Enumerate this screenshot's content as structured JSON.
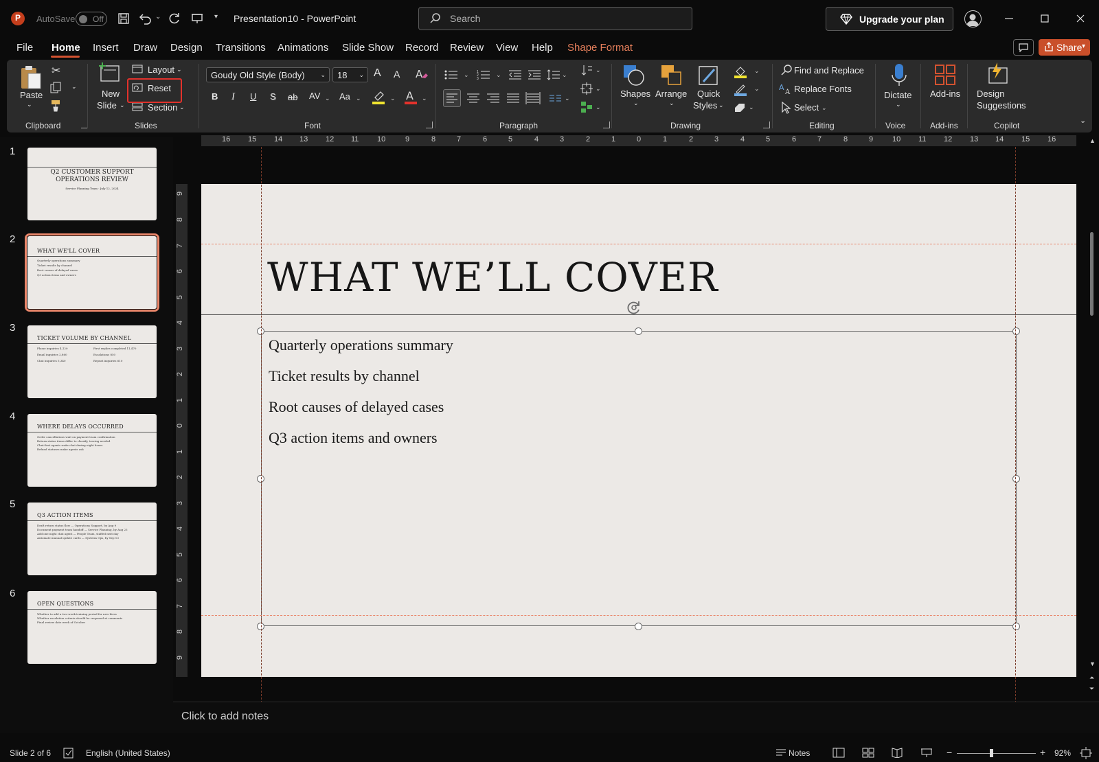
{
  "titlebar": {
    "autosave_label": "AutoSave",
    "autosave_state": "Off",
    "document": "Presentation10",
    "separator": "-",
    "app": "PowerPoint",
    "search_placeholder": "Search",
    "upgrade_label": "Upgrade your plan"
  },
  "menu": {
    "tabs": [
      "File",
      "Home",
      "Insert",
      "Draw",
      "Design",
      "Transitions",
      "Animations",
      "Slide Show",
      "Record",
      "Review",
      "View",
      "Help",
      "Shape Format"
    ],
    "active": "Home",
    "share_label": "Share"
  },
  "ribbon": {
    "clipboard": {
      "paste": "Paste",
      "group": "Clipboard"
    },
    "slides": {
      "new_slide_1": "New",
      "new_slide_2": "Slide",
      "layout": "Layout",
      "reset": "Reset",
      "section": "Section",
      "group": "Slides"
    },
    "font": {
      "family": "Goudy Old Style (Body)",
      "size": "18",
      "group": "Font",
      "bold": "B",
      "italic": "I",
      "underline": "U",
      "shadow": "S",
      "strike": "ab",
      "spacing": "AV",
      "case": "Aa",
      "grow": "A",
      "shrink": "A",
      "color": "A"
    },
    "paragraph": {
      "group": "Paragraph"
    },
    "drawing": {
      "shapes": "Shapes",
      "arrange": "Arrange",
      "quick_styles_1": "Quick",
      "quick_styles_2": "Styles",
      "group": "Drawing"
    },
    "editing": {
      "find_replace": "Find and Replace",
      "replace_fonts": "Replace Fonts",
      "select": "Select",
      "group": "Editing"
    },
    "voice": {
      "dictate": "Dictate",
      "group": "Voice"
    },
    "addins": {
      "addins": "Add-ins",
      "group": "Add-ins"
    },
    "copilot": {
      "design_1": "Design",
      "design_2": "Suggestions",
      "group": "Copilot"
    }
  },
  "thumbnails": [
    {
      "num": "1",
      "title_1": "Q2 CUSTOMER SUPPORT",
      "title_2": "OPERATIONS REVIEW",
      "subtitle": "Service Planning Team · July 12, 2024"
    },
    {
      "num": "2",
      "title": "WHAT WE'LL COVER",
      "lines": [
        "Quarterly operations summary",
        "Ticket results by channel",
        "Root causes of delayed cases",
        "Q3 action items and owners"
      ]
    },
    {
      "num": "3",
      "title": "TICKET VOLUME BY CHANNEL",
      "col1": [
        "Phone inquiries 4,120",
        "Email inquiries 2,860",
        "Chat inquiries 5,340"
      ],
      "col2": [
        "First replies completed 11,470",
        "Escalations 850",
        "Repeat inquiries 610"
      ]
    },
    {
      "num": "4",
      "title": "WHERE DELAYS OCCURRED",
      "lines": [
        "Order cancellations wait on payment team confirmation",
        "Return status items differ to classify, tracing needed",
        "Chat-first agents write chat during night hours",
        "Refund statuses make agents ask"
      ]
    },
    {
      "num": "5",
      "title": "Q3 ACTION ITEMS",
      "lines": [
        "Draft return status flow — Operations Support, by Aug 9",
        "Document payment team handoff — Service Planning, by Aug 23",
        "Add one night chat agent — People Team, staffed next day",
        "Automate manual update cards — Systems Ops, by Sep 13"
      ]
    },
    {
      "num": "6",
      "title": "OPEN QUESTIONS",
      "lines": [
        "Whether to add a two-week training period for new hires",
        "Whether escalation criteria should be reopened at comments",
        "Final review date week of October"
      ]
    }
  ],
  "slide": {
    "title": "WHAT WE’LL COVER",
    "bullets": [
      "Quarterly operations summary",
      "Ticket results by channel",
      "Root causes of delayed cases",
      "Q3 action items and owners"
    ]
  },
  "rulers": {
    "horizontal": [
      "16",
      "15",
      "14",
      "13",
      "12",
      "11",
      "10",
      "9",
      "8",
      "7",
      "6",
      "5",
      "4",
      "3",
      "2",
      "1",
      "0",
      "1",
      "2",
      "3",
      "4",
      "5",
      "6",
      "7",
      "8",
      "9",
      "10",
      "11",
      "12",
      "13",
      "14",
      "15",
      "16"
    ],
    "vertical": [
      "9",
      "8",
      "7",
      "6",
      "5",
      "4",
      "3",
      "2",
      "1",
      "0",
      "1",
      "2",
      "3",
      "4",
      "5",
      "6",
      "7",
      "8",
      "9"
    ]
  },
  "notes": {
    "placeholder": "Click to add notes"
  },
  "status": {
    "slide_position": "Slide 2 of 6",
    "language": "English (United States)",
    "notes": "Notes",
    "zoom": "92%",
    "zoom_minus": "−",
    "zoom_plus": "+"
  },
  "colors": {
    "accent": "#d35230",
    "highlight_box": "#e3322c",
    "selected_thumb": "#e9866a"
  }
}
